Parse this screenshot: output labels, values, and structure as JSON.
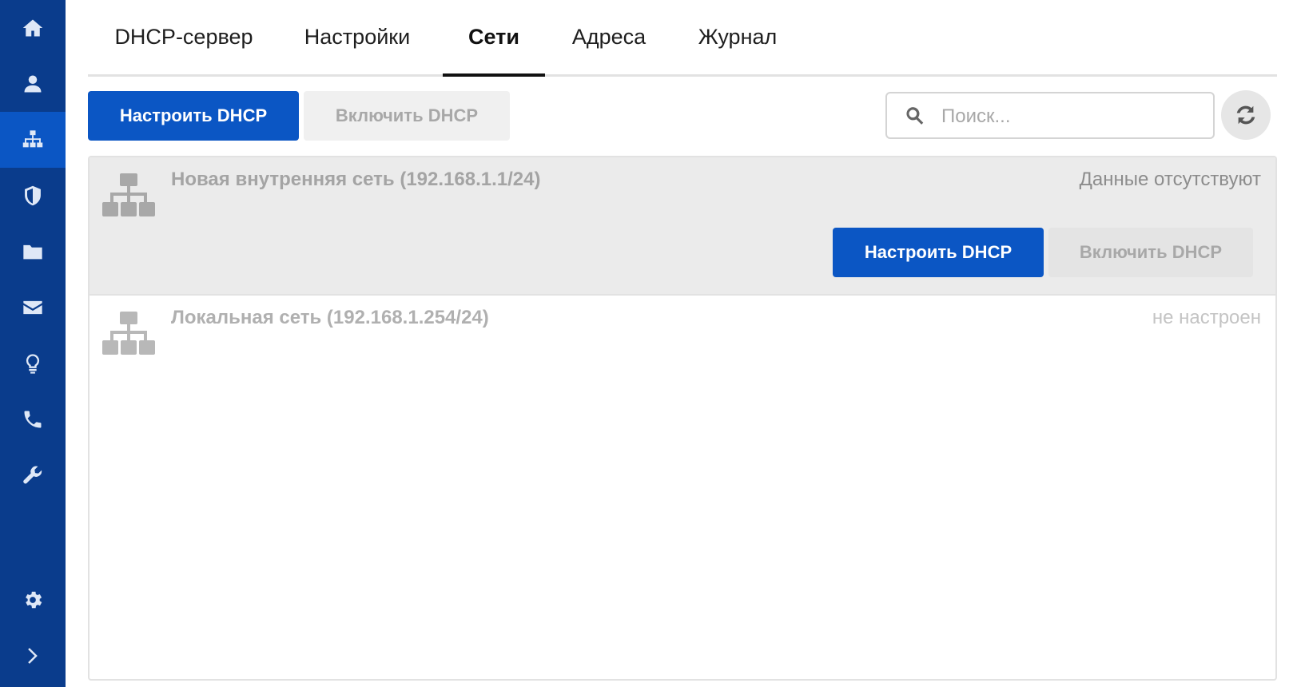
{
  "sidebar": {
    "items": [
      {
        "icon": "home-icon"
      },
      {
        "icon": "user-icon"
      },
      {
        "icon": "network-icon",
        "active": true
      },
      {
        "icon": "shield-icon"
      },
      {
        "icon": "folder-icon"
      },
      {
        "icon": "envelope-icon"
      },
      {
        "icon": "lightbulb-icon"
      },
      {
        "icon": "phone-icon"
      },
      {
        "icon": "wrench-icon"
      }
    ],
    "bottom": [
      {
        "icon": "gear-icon"
      },
      {
        "icon": "chevron-right-icon"
      }
    ]
  },
  "tabs": [
    {
      "label": "DHCP-сервер"
    },
    {
      "label": "Настройки"
    },
    {
      "label": "Сети",
      "active": true
    },
    {
      "label": "Адреса"
    },
    {
      "label": "Журнал"
    }
  ],
  "toolbar": {
    "configure_label": "Настроить DHCP",
    "enable_label": "Включить DHCP",
    "search_placeholder": "Поиск...",
    "search_icon": "search-icon",
    "refresh_icon": "refresh-icon"
  },
  "networks": [
    {
      "name": "Новая внутренняя сеть (192.168.1.1/24)",
      "status": "Данные отсутствуют",
      "selected": true,
      "configure_label": "Настроить DHCP",
      "enable_label": "Включить DHCP"
    },
    {
      "name": "Локальная сеть (192.168.1.254/24)",
      "status": "не настроен",
      "selected": false
    }
  ],
  "colors": {
    "sidebar": "#0a3c8c",
    "sidebar_active": "#0b56c4",
    "primary": "#0b56c4"
  }
}
